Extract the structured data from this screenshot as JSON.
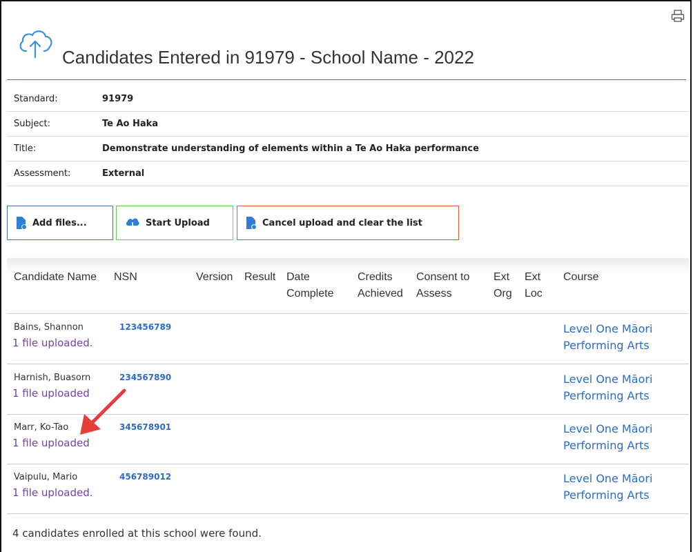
{
  "page": {
    "title": "Candidates Entered in 91979 - School Name - 2022"
  },
  "info": [
    {
      "label": "Standard:",
      "value": "91979"
    },
    {
      "label": "Subject:",
      "value": "Te Ao Haka"
    },
    {
      "label": "Title:",
      "value": "Demonstrate understanding of elements within a Te Ao Haka performance"
    },
    {
      "label": "Assessment:",
      "value": "External"
    }
  ],
  "buttons": {
    "add": "Add files...",
    "upload": "Start Upload",
    "cancel": "Cancel upload and clear the list"
  },
  "table": {
    "headers": {
      "name": "Candidate Name",
      "nsn": "NSN",
      "version": "Version",
      "result": "Result",
      "date_1": "Date",
      "date_2": "Complete",
      "credits_1": "Credits",
      "credits_2": "Achieved",
      "consent_1": "Consent to",
      "consent_2": "Assess",
      "extorg_1": "Ext",
      "extorg_2": "Org",
      "extloc_1": "Ext",
      "extloc_2": "Loc",
      "course": "Course"
    },
    "rows": [
      {
        "name": "Bains, Shannon",
        "files": "1 file uploaded.",
        "nsn": "123456789",
        "course_1": "Level One Māori",
        "course_2": "Performing Arts"
      },
      {
        "name": "Harnish, Buasorn",
        "files": "1 file uploaded",
        "nsn": "234567890",
        "course_1": "Level One Māori",
        "course_2": "Performing Arts"
      },
      {
        "name": "Marr, Ko-Tao",
        "files": "1 file uploaded",
        "nsn": "345678901",
        "course_1": "Level One Māori",
        "course_2": "Performing Arts"
      },
      {
        "name": "Vaipulu, Mario",
        "files": "1 file uploaded.",
        "nsn": "456789012",
        "course_1": "Level One Māori",
        "course_2": "Performing Arts"
      }
    ]
  },
  "footer": "4 candidates enrolled at this school were found.",
  "colors": {
    "accent": "#3b75b8",
    "link": "#2a6cc7",
    "uploaded": "#7a3db0",
    "upload_btn": "#66cc55",
    "cancel_btn": "#e8542d",
    "arrow": "#e83b3b"
  },
  "icons": {
    "print": "printer-icon",
    "cloud": "cloud-upload-icon",
    "add": "file-add-icon",
    "upload": "cloud-upload-small-icon",
    "cancel": "file-cancel-icon",
    "annotation": "red-arrow"
  }
}
